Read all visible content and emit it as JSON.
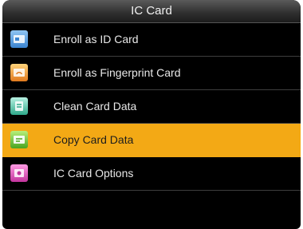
{
  "title": "IC Card",
  "menu": [
    {
      "label": "Enroll as ID Card",
      "icon": "id-card-icon"
    },
    {
      "label": "Enroll as Fingerprint Card",
      "icon": "fingerprint-card-icon"
    },
    {
      "label": "Clean Card Data",
      "icon": "clean-card-icon"
    },
    {
      "label": "Copy Card Data",
      "icon": "copy-card-icon",
      "selected": true
    },
    {
      "label": "IC Card Options",
      "icon": "card-options-icon"
    }
  ],
  "colors": {
    "selected": "#f3a915",
    "background": "#000000"
  }
}
